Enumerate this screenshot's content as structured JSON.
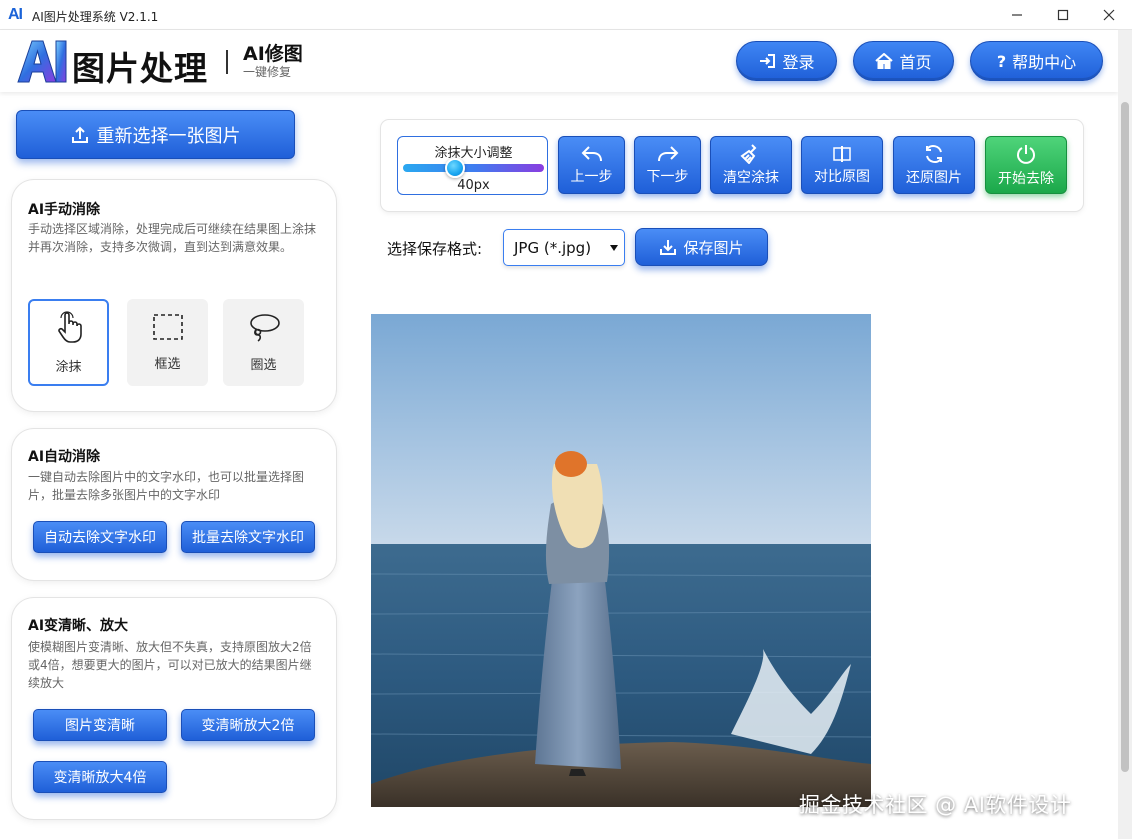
{
  "window": {
    "icon_text": "AI",
    "title": "AI图片处理系统 V2.1.1"
  },
  "header": {
    "brand_title": "图片处理",
    "brand_sub1": "AI修图",
    "brand_sub2": "一键修复",
    "buttons": [
      {
        "label": "登录",
        "icon": "login-icon"
      },
      {
        "label": "首页",
        "icon": "home-icon"
      },
      {
        "label": "帮助中心",
        "icon": "question-icon",
        "prefix": "?"
      }
    ]
  },
  "left": {
    "reselect_label": "重新选择一张图片",
    "manual": {
      "title": "AI手动消除",
      "desc": "手动选择区域消除，处理完成后可继续在结果图上涂抹并再次消除，支持多次微调，直到达到满意效果。",
      "tools": [
        {
          "label": "涂抹",
          "icon": "hand-pointer-icon",
          "active": true
        },
        {
          "label": "框选",
          "icon": "dashed-rect-icon",
          "active": false
        },
        {
          "label": "圈选",
          "icon": "lasso-icon",
          "active": false
        }
      ]
    },
    "auto": {
      "title": "AI自动消除",
      "desc": "一键自动去除图片中的文字水印，也可以批量选择图片，批量去除多张图片中的文字水印",
      "buttons": [
        "自动去除文字水印",
        "批量去除文字水印"
      ]
    },
    "enhance": {
      "title": "AI变清晰、放大",
      "desc": "使模糊图片变清晰、放大但不失真，支持原图放大2倍或4倍，想要更大的图片，可以对已放大的结果图片继续放大",
      "buttons": [
        "图片变清晰",
        "变清晰放大2倍",
        "变清晰放大4倍"
      ]
    }
  },
  "toolbar": {
    "brush": {
      "label": "涂抹大小调整",
      "value": "40px",
      "level": 0.37
    },
    "buttons": [
      {
        "label": "上一步",
        "icon": "undo-icon"
      },
      {
        "label": "下一步",
        "icon": "redo-icon"
      },
      {
        "label": "清空涂抹",
        "icon": "broom-icon"
      },
      {
        "label": "对比原图",
        "icon": "compare-icon"
      },
      {
        "label": "还原图片",
        "icon": "refresh-icon"
      },
      {
        "label": "开始去除",
        "icon": "power-icon"
      }
    ]
  },
  "save": {
    "format_label": "选择保存格式:",
    "format_value": "JPG (*.jpg)",
    "save_label": "保存图片"
  },
  "watermark": "掘金技术社区 @ AI软件设计",
  "colors": {
    "primary": "#2f6fe0",
    "success": "#1ba84a"
  }
}
